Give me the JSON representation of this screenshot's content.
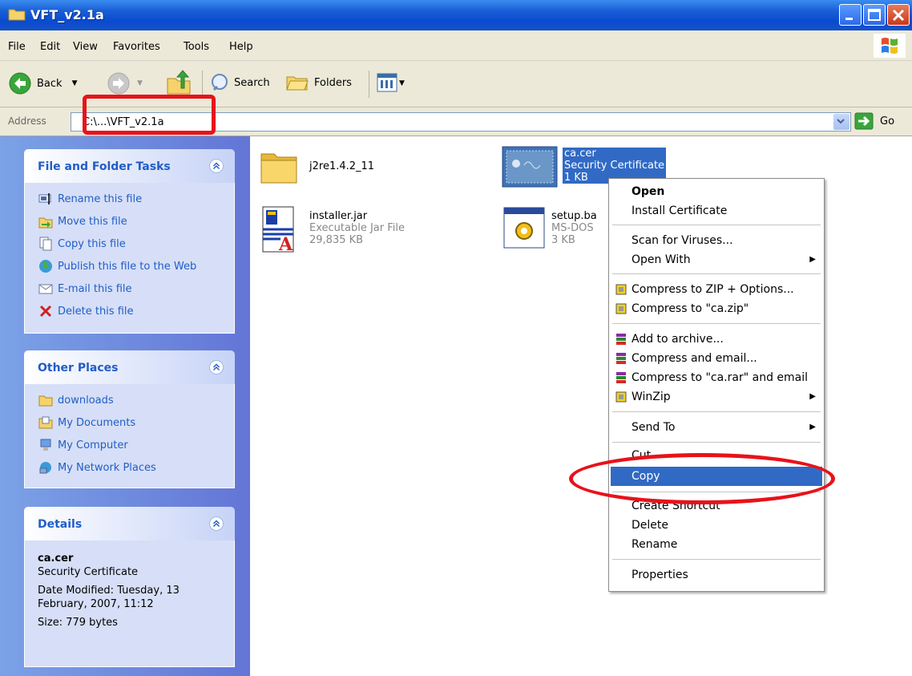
{
  "window": {
    "title": "VFT_v2.1a"
  },
  "menubar": [
    "File",
    "Edit",
    "View",
    "Favorites",
    "Tools",
    "Help"
  ],
  "toolbar": {
    "back": "Back",
    "search": "Search",
    "folders": "Folders"
  },
  "address": {
    "label": "Address",
    "value": "C:\\...\\VFT_v2.1a",
    "go": "Go"
  },
  "tasks_panel": {
    "title": "File and Folder Tasks",
    "items": [
      "Rename this file",
      "Move this file",
      "Copy this file",
      "Publish this file to the Web",
      "E-mail this file",
      "Delete this file"
    ]
  },
  "places_panel": {
    "title": "Other Places",
    "items": [
      "downloads",
      "My Documents",
      "My Computer",
      "My Network Places"
    ]
  },
  "details_panel": {
    "title": "Details",
    "name": "ca.cer",
    "type": "Security Certificate",
    "modified": "Date Modified: Tuesday, 13 February, 2007, 11:12",
    "size": "Size: 779 bytes"
  },
  "files": [
    {
      "name": "j2re1.4.2_11",
      "type": "",
      "size": ""
    },
    {
      "name": "ca.cer",
      "type": "Security Certificate",
      "size": "1 KB"
    },
    {
      "name": "installer.jar",
      "type": "Executable Jar File",
      "size": "29,835 KB"
    },
    {
      "name": "setup.ba",
      "type": "MS-DOS",
      "size": "3 KB"
    }
  ],
  "context_menu": {
    "open": "Open",
    "install": "Install Certificate",
    "scan": "Scan for Viruses...",
    "open_with": "Open With",
    "zip_options": "Compress to ZIP + Options...",
    "zip": "Compress to \"ca.zip\"",
    "add_archive": "Add to archive...",
    "compress_email": "Compress and email...",
    "rar_email": "Compress to \"ca.rar\" and email",
    "winzip": "WinZip",
    "send_to": "Send To",
    "cut": "Cut",
    "copy": "Copy",
    "shortcut": "Create Shortcut",
    "delete": "Delete",
    "rename": "Rename",
    "properties": "Properties"
  },
  "colors": {
    "selection": "#316ac5",
    "annotation": "#e8121a",
    "link": "#215dc6"
  }
}
